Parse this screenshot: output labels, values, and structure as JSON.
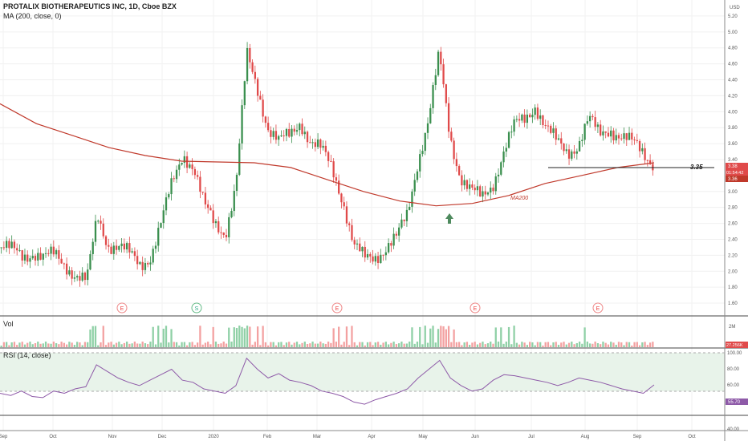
{
  "header": {
    "symbol_line": "PROTALIX BIOTHERAPEUTICS INC, 1D, Cboe BZX",
    "ma_line": "MA (200, close, 0)",
    "vol_label": "Vol",
    "rsi_label": "RSI (14, close)"
  },
  "price_axis": {
    "currency": "USD",
    "ticks": [
      "5.20",
      "5.00",
      "4.80",
      "4.60",
      "4.40",
      "4.20",
      "4.00",
      "3.80",
      "3.60",
      "3.40",
      "3.00",
      "2.80",
      "2.60",
      "2.40",
      "2.20",
      "2.00",
      "1.80",
      "1.60"
    ],
    "last_price_tag": "3.38",
    "countdown_tag": "01:54:42",
    "ma_tag": "3.36"
  },
  "vol_axis": {
    "ticks": [
      "2M"
    ],
    "last_tag": "27.256K"
  },
  "rsi_axis": {
    "ticks": [
      "100.00",
      "80.00",
      "60.00",
      "40.00"
    ],
    "last_tag": "55.70"
  },
  "time_axis": [
    "Sep",
    "Oct",
    "Nov",
    "Dec",
    "2020",
    "Feb",
    "Mar",
    "Apr",
    "May",
    "Jun",
    "Jul",
    "Aug",
    "Sep",
    "Oct"
  ],
  "annotations": {
    "support_level": "3.35",
    "ma_label": "MA200",
    "earnings_markers": [
      "E",
      "S",
      "E",
      "E",
      "E"
    ]
  },
  "colors": {
    "up": "#3a8f4e",
    "down": "#e04a4a",
    "ma": "#c0392b",
    "rsi": "#8e5aa8",
    "rsi_band": "#e8f3ea",
    "arrow": "#4e8a5e"
  },
  "chart_data": [
    {
      "type": "candlestick",
      "title": "PROTALIX BIOTHERAPEUTICS INC, 1D, Cboe BZX",
      "ylabel": "USD",
      "ylim": [
        1.5,
        5.35
      ],
      "x": [
        "Sep",
        "Oct",
        "Nov",
        "Dec",
        "2020",
        "Feb",
        "Mar",
        "Apr",
        "May",
        "Jun",
        "Jul",
        "Aug",
        "Sep"
      ],
      "close_path": [
        2.3,
        2.25,
        2.2,
        2.25,
        2.15,
        2.2,
        2.1,
        1.95,
        1.85,
        2.7,
        2.35,
        2.3,
        2.2,
        2.1,
        2.2,
        2.6,
        3.1,
        3.5,
        3.3,
        2.8,
        2.6,
        2.5,
        3.1,
        4.7,
        4.3,
        3.8,
        3.6,
        3.7,
        3.9,
        3.6,
        3.5,
        3.3,
        2.9,
        2.3,
        2.15,
        2.2,
        2.3,
        2.4,
        2.7,
        3.4,
        3.9,
        4.7,
        3.7,
        3.2,
        3.0,
        2.9,
        3.1,
        3.5,
        3.8,
        3.9,
        4.1,
        3.8,
        3.6,
        3.5,
        3.6,
        3.9,
        3.7,
        3.8,
        3.7,
        3.6,
        3.5,
        3.38
      ],
      "series": [
        {
          "name": "MA (200, close, 0)",
          "values": [
            4.1,
            3.85,
            3.7,
            3.55,
            3.45,
            3.38,
            3.37,
            3.36,
            3.3,
            3.15,
            3.0,
            2.88,
            2.82,
            2.85,
            2.95,
            3.1,
            3.2,
            3.3,
            3.36
          ]
        }
      ],
      "annotations": [
        {
          "label": "3.35",
          "y": 3.35
        },
        {
          "label": "MA200"
        }
      ]
    },
    {
      "type": "bar",
      "title": "Vol",
      "ylabel": "",
      "last_value": "27.256K"
    },
    {
      "type": "line",
      "title": "RSI (14, close)",
      "ylim": [
        30,
        100
      ],
      "values": [
        48,
        46,
        50,
        45,
        44,
        50,
        48,
        52,
        54,
        74,
        68,
        62,
        58,
        55,
        60,
        65,
        70,
        60,
        58,
        52,
        50,
        48,
        55,
        80,
        70,
        62,
        66,
        60,
        58,
        55,
        50,
        48,
        45,
        40,
        38,
        42,
        45,
        48,
        52,
        62,
        70,
        78,
        62,
        55,
        50,
        52,
        60,
        65,
        64,
        62,
        60,
        58,
        55,
        58,
        62,
        60,
        58,
        55,
        52,
        50,
        48,
        55.7
      ]
    }
  ]
}
